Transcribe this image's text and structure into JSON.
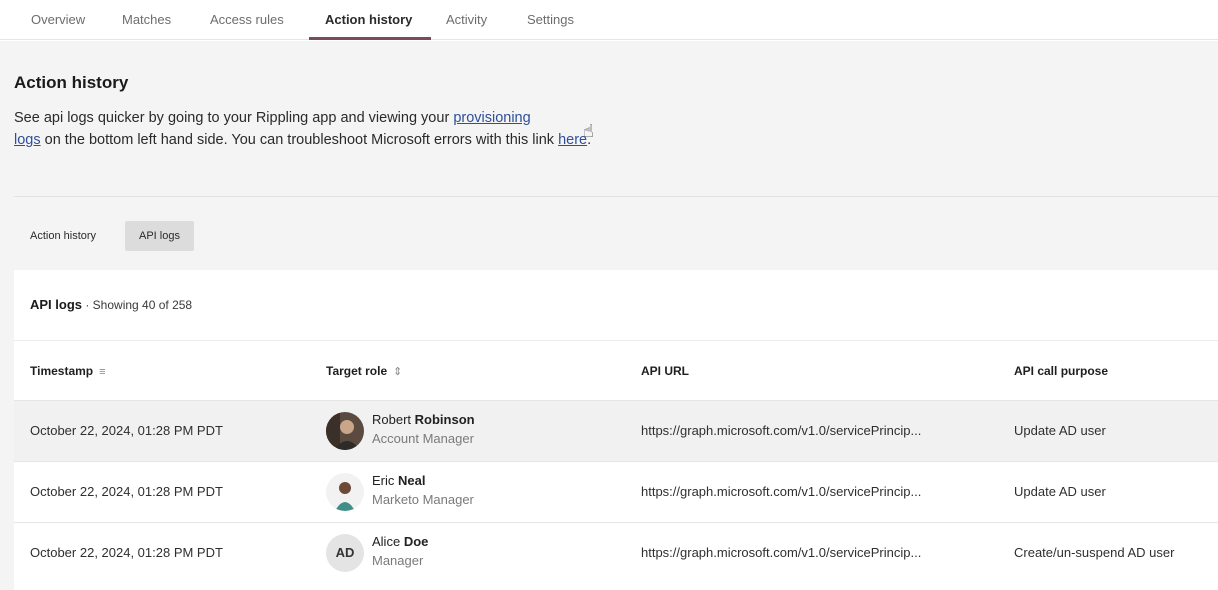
{
  "tabs": [
    {
      "label": "Overview"
    },
    {
      "label": "Matches"
    },
    {
      "label": "Access rules"
    },
    {
      "label": "Action history",
      "active": true
    },
    {
      "label": "Activity"
    },
    {
      "label": "Settings"
    }
  ],
  "page": {
    "title": "Action history",
    "desc_part1": "See api logs quicker by going to your Rippling app and viewing your ",
    "link_provisioning": "provisioning",
    "desc_line2_link": "logs",
    "desc_part2": " on the bottom left hand side. You can troubleshoot Microsoft errors with this link ",
    "link_here": "here",
    "desc_end": "."
  },
  "subtabs": [
    {
      "label": "Action history"
    },
    {
      "label": "API logs",
      "active": true
    }
  ],
  "card": {
    "title": "API logs",
    "subtitle": " · Showing 40 of 258"
  },
  "table": {
    "columns": [
      "Timestamp",
      "Target role",
      "API URL",
      "API call purpose"
    ],
    "rows": [
      {
        "timestamp": "October 22, 2024, 01:28 PM PDT",
        "first_name": "Robert",
        "last_name": "Robinson",
        "role": "Account Manager",
        "avatar": "photo",
        "url": "https://graph.microsoft.com/v1.0/servicePrincip...",
        "purpose": "Update AD user"
      },
      {
        "timestamp": "October 22, 2024, 01:28 PM PDT",
        "first_name": "Eric",
        "last_name": "Neal",
        "role": "Marketo Manager",
        "avatar": "photo",
        "url": "https://graph.microsoft.com/v1.0/servicePrincip...",
        "purpose": "Update AD user"
      },
      {
        "timestamp": "October 22, 2024, 01:28 PM PDT",
        "first_name": "Alice",
        "last_name": "Doe",
        "role": "Manager",
        "avatar_initials": "AD",
        "url": "https://graph.microsoft.com/v1.0/servicePrincip...",
        "purpose": "Create/un-suspend AD user"
      }
    ]
  },
  "colors": {
    "accent_tab": "#7a4b5d",
    "link": "#2f4f9a",
    "page_bg": "#f4f4f4"
  }
}
